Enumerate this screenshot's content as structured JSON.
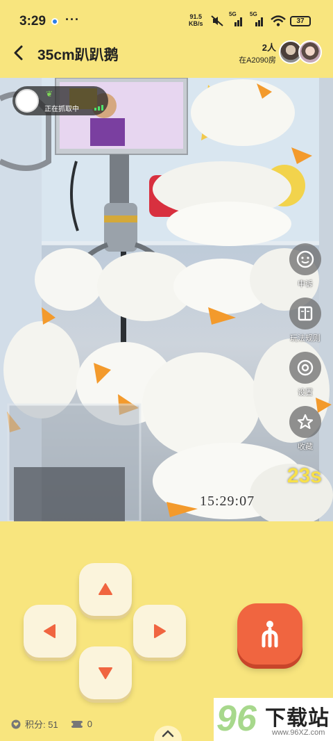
{
  "status_bar": {
    "time": "3:29",
    "more": "···",
    "net_speed_top": "91.5",
    "net_speed_bottom": "KB/s",
    "signal1_label": "5G",
    "signal2_label": "5G",
    "battery": "37"
  },
  "header": {
    "title": "35cm趴趴鹅",
    "people_count": "2人",
    "room": "在A2090房"
  },
  "video": {
    "status_text": "正在抓取中",
    "countdown": "23s",
    "timestamp": "15:29:07"
  },
  "side_menu": [
    {
      "label": "申诉",
      "icon": "face-icon"
    },
    {
      "label": "玩法规则",
      "icon": "book-icon"
    },
    {
      "label": "设置",
      "icon": "settings-icon"
    },
    {
      "label": "收藏",
      "icon": "star-icon"
    }
  ],
  "footer": {
    "points": "积分: 51",
    "tickets": "0"
  },
  "watermark": {
    "number": "96",
    "name": "下载站",
    "url": "www.96XZ.com"
  },
  "colors": {
    "background": "#f8e57e",
    "grab_button": "#f06540",
    "countdown": "#f7e04a",
    "arrow": "#f06540"
  }
}
